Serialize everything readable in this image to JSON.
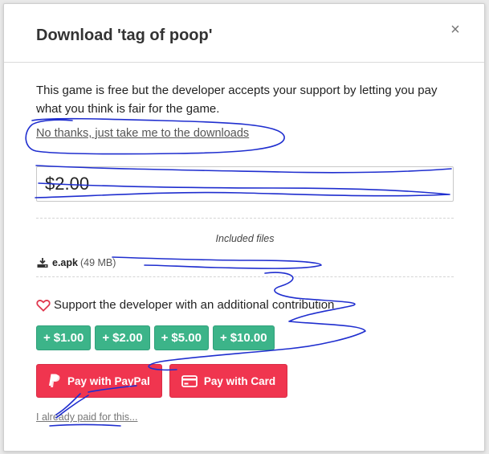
{
  "dialog": {
    "title": "Download 'tag of poop'",
    "close_glyph": "×",
    "close_icon": "close-icon"
  },
  "intro_text": "This game is free but the developer accepts your support by letting you pay what you think is fair for the game.",
  "no_thanks_link": "No thanks, just take me to the downloads",
  "price_input": {
    "value": "$2.00"
  },
  "included_files": {
    "label": "Included files",
    "files": [
      {
        "icon": "download-icon",
        "name": "e.apk",
        "size": "(49 MB)"
      }
    ]
  },
  "support": {
    "icon": "heart-icon",
    "text": "Support the developer with an additional contribution"
  },
  "contributions": [
    {
      "plus": "+",
      "amount": "$1.00"
    },
    {
      "plus": "+",
      "amount": "$2.00"
    },
    {
      "plus": "+",
      "amount": "$5.00"
    },
    {
      "plus": "+",
      "amount": "$10.00"
    }
  ],
  "payment": {
    "paypal_label": "Pay with PayPal",
    "paypal_icon": "paypal-icon",
    "card_label": "Pay with Card",
    "card_icon": "credit-card-icon"
  },
  "already_paid_link": "I already paid for this...",
  "colors": {
    "contribution_green": "#3cb489",
    "pay_red": "#f0354f",
    "scribble_blue": "#1f2ecf"
  }
}
